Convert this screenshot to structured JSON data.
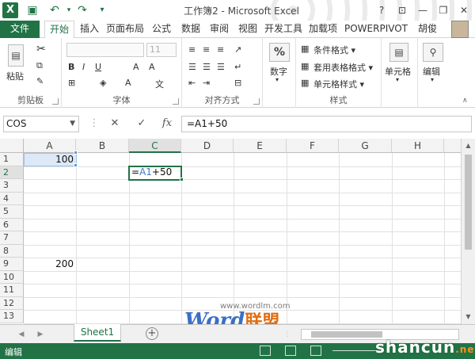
{
  "window": {
    "title": "工作簿2 - Microsoft Excel",
    "app_icon": "X",
    "controls": [
      "?",
      "⊡",
      "—",
      "❐",
      "✕"
    ]
  },
  "ribbon": {
    "tabs": [
      "文件",
      "开始",
      "插入",
      "页面布局",
      "公式",
      "数据",
      "审阅",
      "视图",
      "开发工具",
      "加载项",
      "POWERPIVOT",
      "胡俊"
    ],
    "active_tab": "开始",
    "groups": {
      "clipboard": {
        "paste": "粘贴",
        "label": "剪贴板"
      },
      "font": {
        "size": "11",
        "label": "字体"
      },
      "alignment": {
        "label": "对齐方式"
      },
      "number": {
        "symbol": "%",
        "button": "数字"
      },
      "styles": {
        "items": [
          "条件格式 ▾",
          "套用表格格式 ▾",
          "单元格样式 ▾"
        ],
        "label": "样式"
      },
      "cells": {
        "button": "单元格"
      },
      "editing": {
        "button": "编辑"
      }
    }
  },
  "formula_bar": {
    "name_box": "COS",
    "cancel": "✕",
    "enter": "✓",
    "fx": "fx",
    "formula": "=A1+50"
  },
  "sheet": {
    "columns": [
      "A",
      "B",
      "C",
      "D",
      "E",
      "F",
      "G",
      "H"
    ],
    "rows": [
      "1",
      "2",
      "3",
      "4",
      "5",
      "6",
      "7",
      "8",
      "9",
      "10",
      "11",
      "12",
      "13"
    ],
    "selected_column": "C",
    "selected_row": "2",
    "cells": {
      "A1": "100",
      "A9": "200"
    },
    "editing": {
      "prefix": "=",
      "ref": "A1",
      "suffix": "+50"
    }
  },
  "sheet_tabs": {
    "tabs": [
      "Sheet1"
    ],
    "active": "Sheet1",
    "add": "+"
  },
  "status_bar": {
    "mode": "编辑"
  },
  "watermarks": {
    "site": "www.wordlm.com",
    "word": "Word",
    "word_cn": "联盟",
    "shancun": "shancun",
    "shancun_net": ".net"
  },
  "colors": {
    "accent": "#217346",
    "ref_blue": "#3f79c4"
  }
}
